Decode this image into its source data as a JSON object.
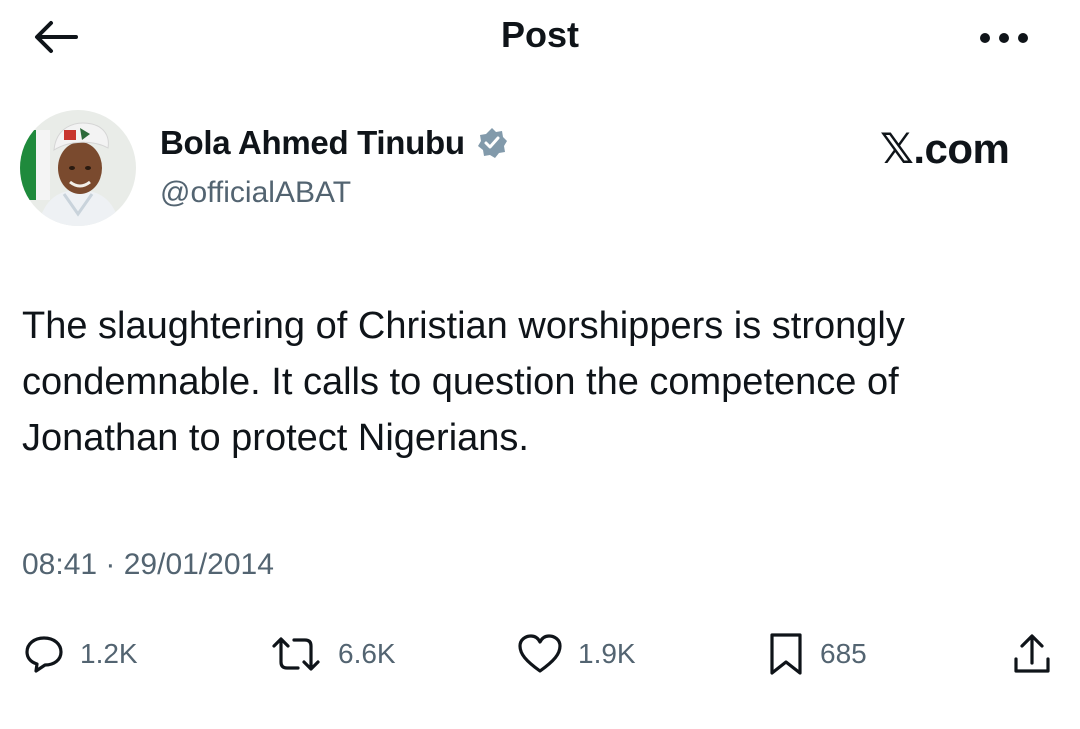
{
  "header": {
    "back_icon": "arrow-left-icon",
    "title": "Post",
    "more_icon": "more-horizontal-icon"
  },
  "author": {
    "display_name": "Bola Ahmed Tinubu",
    "handle": "@officialABAT",
    "verified_icon": "verified-badge-icon",
    "avatar_icon": "avatar-photo"
  },
  "watermark": "𝕏.com",
  "tweet": {
    "text": "The slaughtering of Christian worshippers  is strongly condemnable. It calls to question the competence of Jonathan to protect Nigerians.",
    "timestamp": "08:41 · 29/01/2014"
  },
  "actions": {
    "reply": {
      "icon": "reply-bubble-icon",
      "count": "1.2K"
    },
    "repost": {
      "icon": "repost-icon",
      "count": "6.6K"
    },
    "like": {
      "icon": "heart-icon",
      "count": "1.9K"
    },
    "bookmark": {
      "icon": "bookmark-icon",
      "count": "685"
    },
    "share": {
      "icon": "share-icon"
    }
  },
  "colors": {
    "text_primary": "#0f1419",
    "text_secondary": "#536471",
    "verified_badge": "#829aab",
    "background": "#ffffff"
  }
}
